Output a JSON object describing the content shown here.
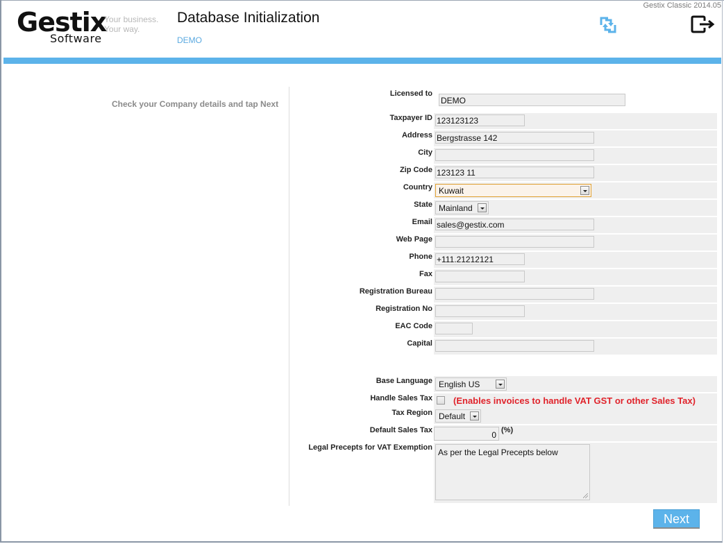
{
  "app": {
    "version": "Gestix Classic 2014.05",
    "logo": {
      "name": "Gestix",
      "sub": "Software",
      "tagline_1": "Your business.",
      "tagline_2": "Your way."
    }
  },
  "header": {
    "title": "Database Initialization",
    "subtitle": "DEMO",
    "icons": [
      "refresh-icon",
      "logout-icon"
    ]
  },
  "colors": {
    "accent": "#5cb3ea",
    "warning": "#e0222a",
    "field_bg": "#efefef",
    "focus": "#e0a030"
  },
  "hint": "Check your Company details and tap Next",
  "form": {
    "licensed_to": {
      "label": "Licensed to",
      "value": "DEMO"
    },
    "taxpayer_id": {
      "label": "Taxpayer ID",
      "value": "123123123"
    },
    "address": {
      "label": "Address",
      "value": "Bergstrasse 142"
    },
    "city": {
      "label": "City",
      "value": ""
    },
    "zip_code": {
      "label": "Zip Code",
      "value": "123123 11"
    },
    "country": {
      "label": "Country",
      "value": "Kuwait"
    },
    "state": {
      "label": "State",
      "value": "Mainland"
    },
    "email": {
      "label": "Email",
      "value": "sales@gestix.com"
    },
    "web_page": {
      "label": "Web Page",
      "value": ""
    },
    "phone": {
      "label": "Phone",
      "value": "+111.21212121"
    },
    "fax": {
      "label": "Fax",
      "value": ""
    },
    "registration_bureau": {
      "label": "Registration Bureau",
      "value": ""
    },
    "registration_no": {
      "label": "Registration No",
      "value": ""
    },
    "eac_code": {
      "label": "EAC Code",
      "value": ""
    },
    "capital": {
      "label": "Capital",
      "value": ""
    },
    "base_language": {
      "label": "Base Language",
      "value": "English US"
    },
    "handle_sales_tax": {
      "label": "Handle Sales Tax",
      "checked": false,
      "note": "(Enables invoices to handle VAT GST or other Sales Tax)"
    },
    "tax_region": {
      "label": "Tax Region",
      "value": "Default"
    },
    "default_sales_tax": {
      "label": "Default Sales Tax",
      "value": "0",
      "unit": "(%)"
    },
    "legal_precepts": {
      "label": "Legal Precepts for VAT Exemption",
      "value": "As per the Legal Precepts below"
    }
  },
  "actions": {
    "next_label": "Next"
  }
}
